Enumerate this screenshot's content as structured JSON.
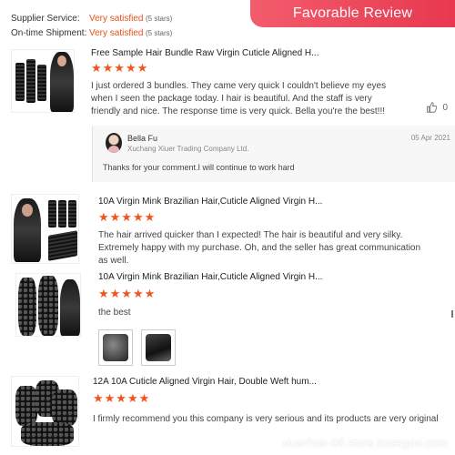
{
  "summary": {
    "supplier_service_label": "Supplier Service:",
    "supplier_service_value": "Very satisfied",
    "supplier_service_stars": "(5 stars)",
    "ontime_label": "On-time Shipment:",
    "ontime_value": "Very satisfied",
    "ontime_stars": "(5 stars)"
  },
  "banner": {
    "title": "Favorable Review"
  },
  "reviews": [
    {
      "title": "Free Sample Hair Bundle Raw Virgin Cuticle Aligned H...",
      "stars": "★★★★★",
      "text": "I just ordered 3 bundles. They came very quick I couldn't believe my eyes when I seen the package today. I hair is beautiful. And the staff is very friendly and nice. The response time is very quick. Bella you're the best!!!",
      "likes": "0",
      "reply": {
        "name": "Bella Fu",
        "company": "Xuchang Xiuer Trading Company Ltd.",
        "date": "05 Apr 2021",
        "message": "Thanks for your comment.I will continue to work hard"
      }
    },
    {
      "title": "10A Virgin Mink Brazilian Hair,Cuticle Aligned Virgin H...",
      "stars": "★★★★★",
      "text": "The hair arrived quicker than I expected! The hair is beautiful and very silky. Extremely happy with my purchase. Oh, and the seller has great communication as well."
    },
    {
      "title": "10A Virgin Mink Brazilian Hair,Cuticle Aligned Virgin H...",
      "stars": "★★★★★",
      "text": "the best"
    },
    {
      "title": "12A 10A Cuticle Aligned Virgin Hair, Double Weft hum...",
      "stars": "★★★★★",
      "text": "I firmly recommend you this company is very serious and its products are very original"
    }
  ],
  "watermark": "xiuerhair-06.store.bossgoo.com",
  "colors": {
    "accent": "#f2541b",
    "banner": "#e8384f",
    "satisfied": "#e8501a"
  }
}
